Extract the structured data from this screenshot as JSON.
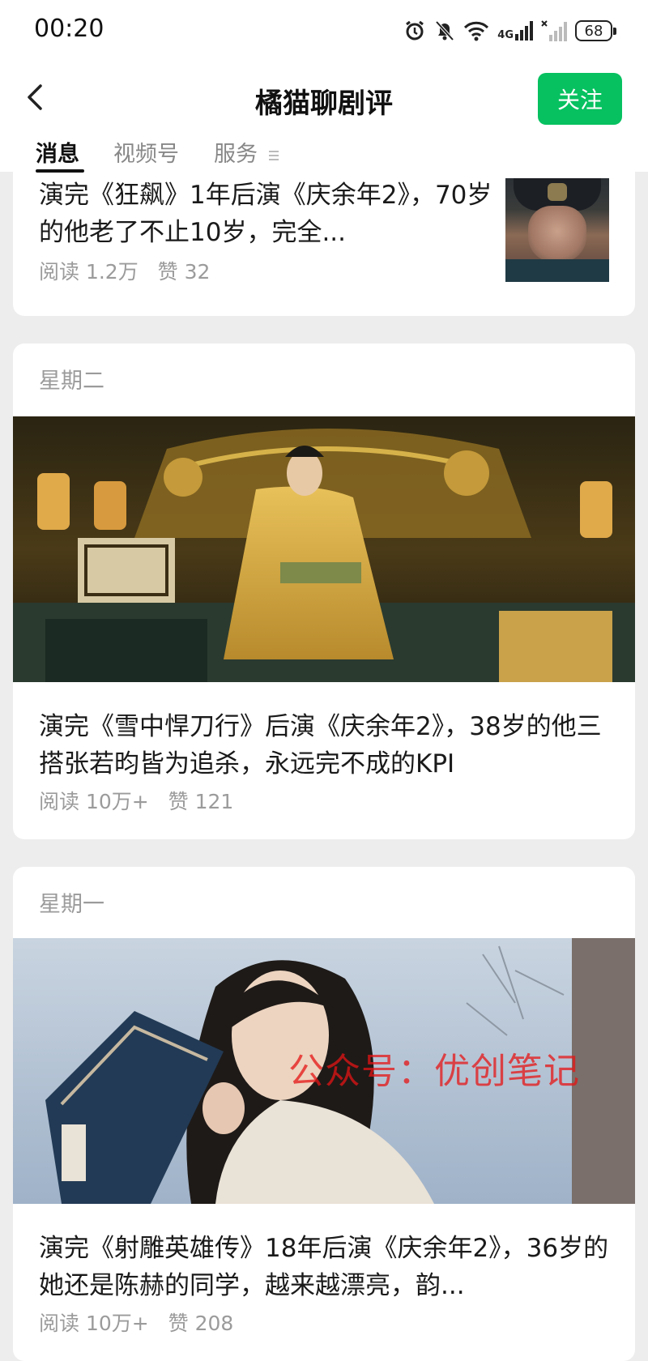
{
  "status_bar": {
    "time": "00:20",
    "network_label": "4G",
    "battery": "68"
  },
  "header": {
    "title": "橘猫聊剧评",
    "follow_label": "关注"
  },
  "tabs": [
    "消息",
    "视频号",
    "服务"
  ],
  "articles": [
    {
      "title": "演完《狂飙》1年后演《庆余年2》，70岁的他老了不止10岁，完全...",
      "reads": "阅读 1.2万",
      "likes": "赞 32"
    },
    {
      "day": "星期二",
      "title": "演完《雪中悍刀行》后演《庆余年2》，38岁的他三搭张若昀皆为追杀，永远完不成的KPI",
      "reads": "阅读 10万+",
      "likes": "赞 121"
    },
    {
      "day": "星期一",
      "watermark": "公众号：优创笔记",
      "title": "演完《射雕英雄传》18年后演《庆余年2》，36岁的她还是陈赫的同学，越来越漂亮，韵...",
      "reads": "阅读 10万+",
      "likes": "赞 208"
    }
  ],
  "colors": {
    "accent": "#07c160",
    "background": "#ededed",
    "meta_text": "#9b9b9b"
  }
}
